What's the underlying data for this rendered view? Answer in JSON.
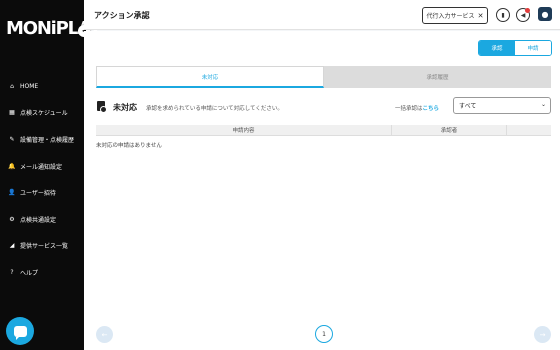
{
  "brand": {
    "logo_text": "MONiPLAT",
    "accent": "#1ba8e0"
  },
  "sidebar": {
    "collapse_icon": "chevron-left-icon",
    "items": [
      {
        "icon": "home-icon",
        "glyph": "⌂",
        "label": "HOME"
      },
      {
        "icon": "calendar-icon",
        "glyph": "▦",
        "label": "点検スケジュール"
      },
      {
        "icon": "wrench-icon",
        "glyph": "✎",
        "label": "設備管理・点検履歴"
      },
      {
        "icon": "bell-icon",
        "glyph": "🔔",
        "label": "メール通知設定"
      },
      {
        "icon": "user-add-icon",
        "glyph": "👤",
        "label": "ユーザー招待"
      },
      {
        "icon": "gear-icon",
        "glyph": "⚙",
        "label": "点検共通設定"
      },
      {
        "icon": "megaphone-icon",
        "glyph": "◢",
        "label": "提供サービス一覧"
      },
      {
        "icon": "help-icon",
        "glyph": "?",
        "label": "ヘルプ"
      }
    ],
    "chat_icon": "chat-bubble-icon"
  },
  "header": {
    "title": "アクション承認",
    "proxy_button": "代行入力サービス",
    "proxy_close": "✕",
    "icons": [
      "building-icon",
      "notification-bell-icon",
      "user-avatar-icon"
    ]
  },
  "main": {
    "segment": {
      "approve": "承認",
      "apply": "申請"
    },
    "tabs": {
      "pending": "未対応",
      "history": "承認履歴"
    },
    "section": {
      "title": "未対応",
      "description": "承認を求められている申請について対応してください。",
      "bulk_prefix": "一括承認は",
      "bulk_link": "こちら",
      "select_value": "すべて"
    },
    "table": {
      "headers": [
        "申請内容",
        "承認者",
        ""
      ],
      "empty_message": "未対応の申請はありません"
    },
    "pagination": {
      "current_page": "1",
      "prev": "←",
      "next": "→"
    }
  }
}
